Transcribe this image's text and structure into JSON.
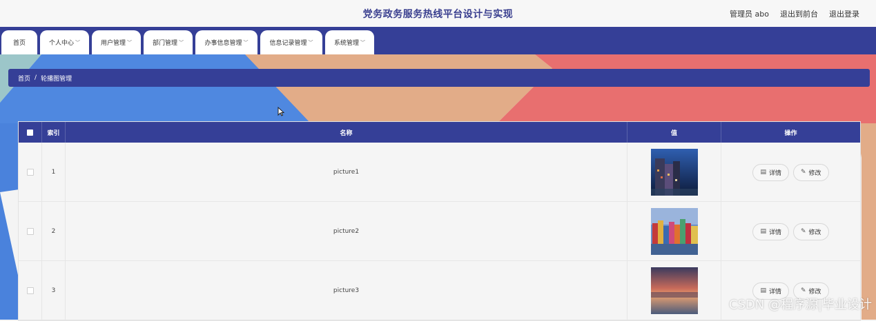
{
  "header": {
    "title": "党务政务服务热线平台设计与实现",
    "links": [
      "管理员 abo",
      "退出到前台",
      "退出登录"
    ]
  },
  "nav": {
    "tabs": [
      {
        "label": "首页",
        "dropdown": false
      },
      {
        "label": "个人中心",
        "dropdown": true
      },
      {
        "label": "用户管理",
        "dropdown": true
      },
      {
        "label": "部门管理",
        "dropdown": true
      },
      {
        "label": "办事信息管理",
        "dropdown": true
      },
      {
        "label": "信息记录管理",
        "dropdown": true
      },
      {
        "label": "系统管理",
        "dropdown": true
      }
    ]
  },
  "breadcrumb": {
    "home": "首页",
    "separator": "/",
    "current": "轮播图管理"
  },
  "table": {
    "headers": {
      "index": "索引",
      "name": "名称",
      "value": "值",
      "actions": "操作"
    },
    "rows": [
      {
        "index": "1",
        "name": "picture1"
      },
      {
        "index": "2",
        "name": "picture2"
      },
      {
        "index": "3",
        "name": "picture3"
      }
    ],
    "actions": {
      "detail": "详情",
      "edit": "修改"
    }
  },
  "watermark": "CSDN @程序源|毕业设计",
  "colors": {
    "primary": "#353f97",
    "blue_panel": "#4f88e0",
    "peach_panel": "#e2ac88",
    "red_panel": "#e86f6f"
  }
}
